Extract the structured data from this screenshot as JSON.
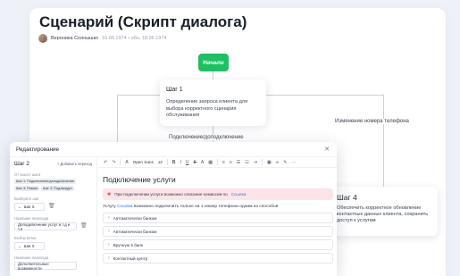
{
  "page": {
    "title": "Сценарий (Скрипт диалога)",
    "author": "Вероника Солнышко",
    "dates": "16.06.1974 • обн. 18.06.1974"
  },
  "flow": {
    "start_label": "Начало",
    "step1": {
      "title": "Шаг 1",
      "description": "Определение запроса клиента для выбора корректного сценария обслуживания"
    },
    "edge_left": "Подключение/доподключение",
    "edge_right": "Изменение номера телефона",
    "step4": {
      "title": "Шаг 4",
      "description": "Обеспечить корректное обновление контактных данных клиента, сохранить доступ к услугам"
    }
  },
  "editor": {
    "title": "Редактирование",
    "close_icon": "close-icon",
    "left": {
      "step_label": "Шаг 2",
      "add_action": "+ Добавить переход",
      "from_label": "От какого шага",
      "chips": [
        "Шаг 1: Подключение/доподключение",
        "Шаг 3: Режим",
        "Шаг 3: Подтвердит"
      ],
      "next_label": "Выберите шаг",
      "next_value": "Шаг 5",
      "transition_label": "Название перехода",
      "transition_value": "Доподключение услуг и т.д и т.п",
      "branch_label": "Выбор ветки",
      "branch_value": "Шаг 6",
      "extra_label": "Название перехода",
      "extra_value": "Дополнительные возможности"
    },
    "toolbar": {
      "font": "Open Sans",
      "size": "12"
    },
    "doc": {
      "title": "Подключение услуги",
      "alert_prefix": "При подключении услуги возможно списание комиссии по",
      "alert_link": "Ссылка",
      "text_prefix": "Услугу",
      "text_link": "Ссылка",
      "text_suffix": "возможно подключить только на 1 номер телефона одним из способов",
      "accordion": [
        "Автоматически банком",
        "Автоматически банком",
        "Вручную в банк",
        "Контактный центр"
      ]
    }
  }
}
